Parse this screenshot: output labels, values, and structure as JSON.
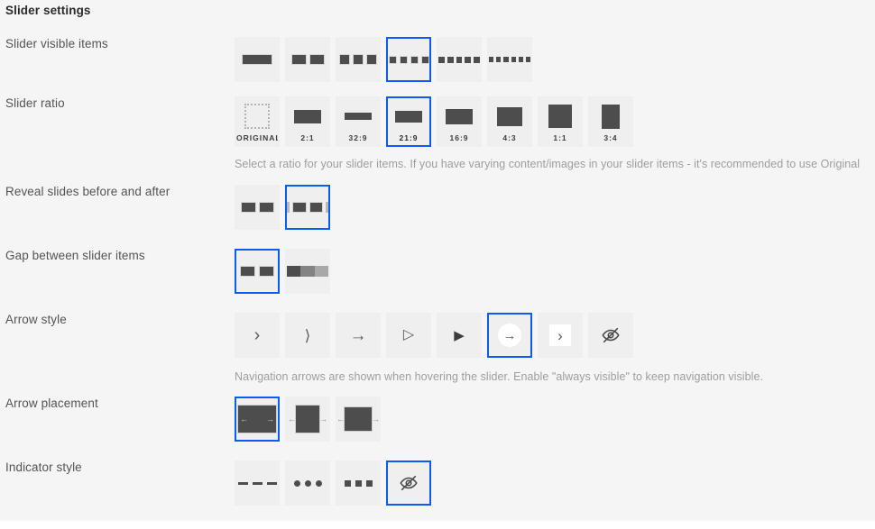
{
  "panel": {
    "title": "Slider settings",
    "background_color": "#f5f5f5",
    "accent_color": "#0a5cf5"
  },
  "rows": {
    "visible_items": {
      "label": "Slider visible items",
      "options": [
        {
          "name": "one-item",
          "count": 1,
          "selected": false
        },
        {
          "name": "two-items",
          "count": 2,
          "selected": false
        },
        {
          "name": "three-items",
          "count": 3,
          "selected": false
        },
        {
          "name": "four-items",
          "count": 4,
          "selected": true
        },
        {
          "name": "five-items",
          "count": 5,
          "selected": false
        },
        {
          "name": "six-items",
          "count": 6,
          "selected": false
        }
      ]
    },
    "ratio": {
      "label": "Slider ratio",
      "helper": "Select a ratio for your slider items. If you have varying content/images in your slider items - it's recommended to use Original",
      "options": [
        {
          "label": "ORIGINAL",
          "selected": false
        },
        {
          "label": "2:1",
          "selected": false
        },
        {
          "label": "32:9",
          "selected": false
        },
        {
          "label": "21:9",
          "selected": true
        },
        {
          "label": "16:9",
          "selected": false
        },
        {
          "label": "4:3",
          "selected": false
        },
        {
          "label": "1:1",
          "selected": false
        },
        {
          "label": "3:4",
          "selected": false
        }
      ]
    },
    "reveal": {
      "label": "Reveal slides before and after",
      "options": [
        {
          "name": "reveal-off",
          "selected": false
        },
        {
          "name": "reveal-on",
          "selected": true
        }
      ]
    },
    "gap": {
      "label": "Gap between slider items",
      "options": [
        {
          "name": "gap-on",
          "selected": true
        },
        {
          "name": "gap-off",
          "selected": false
        }
      ]
    },
    "arrow_style": {
      "label": "Arrow style",
      "helper": "Navigation arrows are shown when hovering the slider. Enable \"always visible\" to keep navigation visible.",
      "options": [
        {
          "name": "chevron-thin-icon",
          "glyph": "›",
          "selected": false
        },
        {
          "name": "chevron-curved-icon",
          "glyph": "⟩",
          "selected": false
        },
        {
          "name": "arrow-right-icon",
          "glyph": "→",
          "selected": false
        },
        {
          "name": "triangle-outline-icon",
          "glyph": "▷",
          "selected": false
        },
        {
          "name": "triangle-filled-icon",
          "glyph": "▶",
          "selected": false
        },
        {
          "name": "arrow-circle-icon",
          "glyph": "→",
          "selected": true
        },
        {
          "name": "chevron-square-icon",
          "glyph": "›",
          "selected": false
        },
        {
          "name": "eye-off-icon",
          "glyph": "eye-off",
          "selected": false
        }
      ]
    },
    "arrow_placement": {
      "label": "Arrow placement",
      "options": [
        {
          "name": "arrows-inside",
          "selected": true
        },
        {
          "name": "arrows-edge",
          "selected": false
        },
        {
          "name": "arrows-outside",
          "selected": false
        }
      ]
    },
    "indicator_style": {
      "label": "Indicator style",
      "options": [
        {
          "name": "indicator-dashes",
          "selected": false
        },
        {
          "name": "indicator-dots",
          "selected": false
        },
        {
          "name": "indicator-squares",
          "selected": false
        },
        {
          "name": "indicator-hidden",
          "selected": true
        }
      ]
    }
  }
}
